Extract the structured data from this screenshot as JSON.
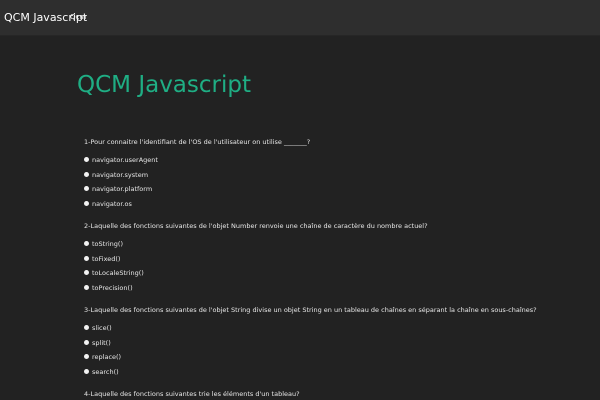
{
  "navbar": {
    "brand": "QCM Javascript",
    "link": "Qcm"
  },
  "page": {
    "title": "QCM Javascript"
  },
  "questions": [
    {
      "text": "1-Pour connaitre l'identifiant de l'OS de l'utilisateur on utilise _______?",
      "options": [
        "navigator.userAgent",
        "navigator.system",
        "navigator.platform",
        "navigator.os"
      ]
    },
    {
      "text": "2-Laquelle des fonctions suivantes de l'objet Number renvoie une chaîne de caractère du nombre actuel?",
      "options": [
        "toString()",
        "toFixed()",
        "toLocaleString()",
        "toPrecision()"
      ]
    },
    {
      "text": "3-Laquelle des fonctions suivantes de l'objet String divise un objet String en un tableau de chaînes en séparant la chaîne en sous-chaînes?",
      "options": [
        "slice()",
        "split()",
        "replace()",
        "search()"
      ]
    },
    {
      "text": "4-Laquelle des fonctions suivantes trie les éléments d'un tableau?"
    }
  ]
}
